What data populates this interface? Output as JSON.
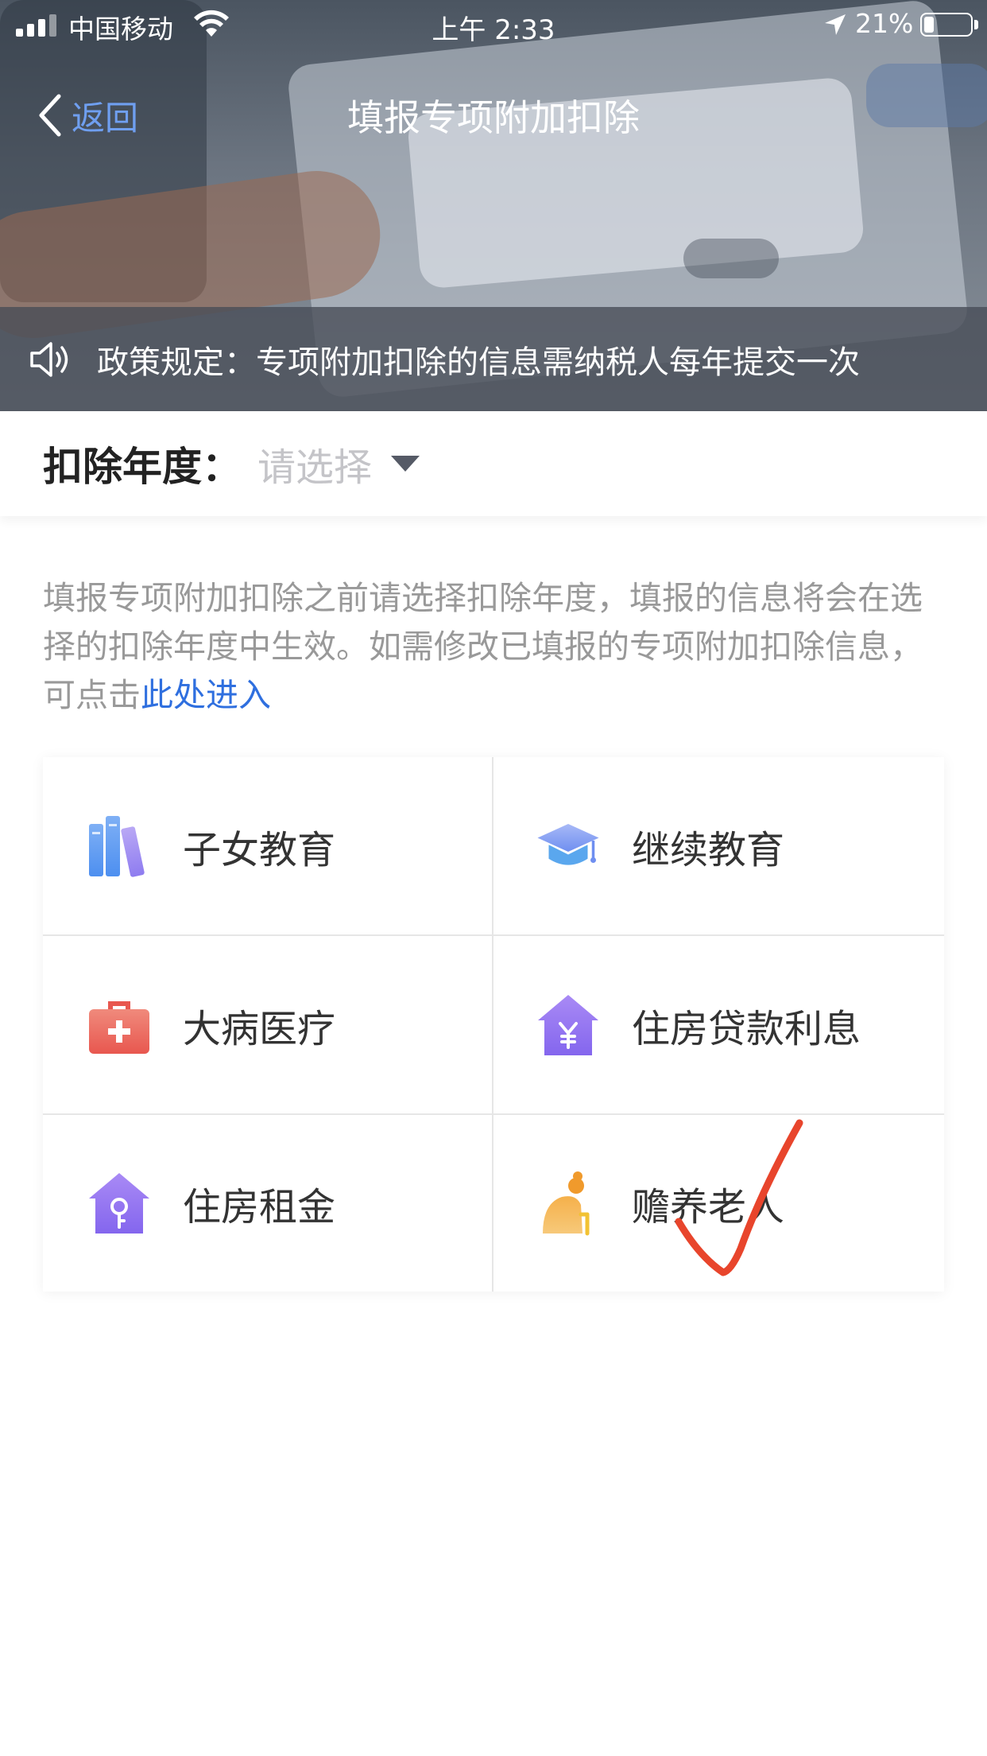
{
  "status_bar": {
    "carrier": "中国移动",
    "time": "上午 2:33",
    "battery_percent_text": "21%",
    "battery_level": 0.21
  },
  "nav": {
    "back_label": "返回",
    "title": "填报专项附加扣除"
  },
  "notice": {
    "text": "政策规定：专项附加扣除的信息需纳税人每年提交一次"
  },
  "year_selector": {
    "label": "扣除年度：",
    "placeholder": "请选择"
  },
  "description": {
    "text": "填报专项附加扣除之前请选择扣除年度，填报的信息将会在选择的扣除年度中生效。如需修改已填报的专项附加扣除信息，可点击",
    "link": "此处进入"
  },
  "categories": [
    {
      "label": "子女教育",
      "icon": "books-icon"
    },
    {
      "label": "继续教育",
      "icon": "graduation-cap-icon"
    },
    {
      "label": "大病医疗",
      "icon": "medical-kit-icon"
    },
    {
      "label": "住房贷款利息",
      "icon": "house-yuan-icon"
    },
    {
      "label": "住房租金",
      "icon": "house-key-icon"
    },
    {
      "label": "赡养老人",
      "icon": "elderly-person-icon"
    }
  ],
  "colors": {
    "link_blue": "#2f6fdf",
    "back_blue": "#6f9ff0",
    "handwritten_check": "#e8452c"
  }
}
